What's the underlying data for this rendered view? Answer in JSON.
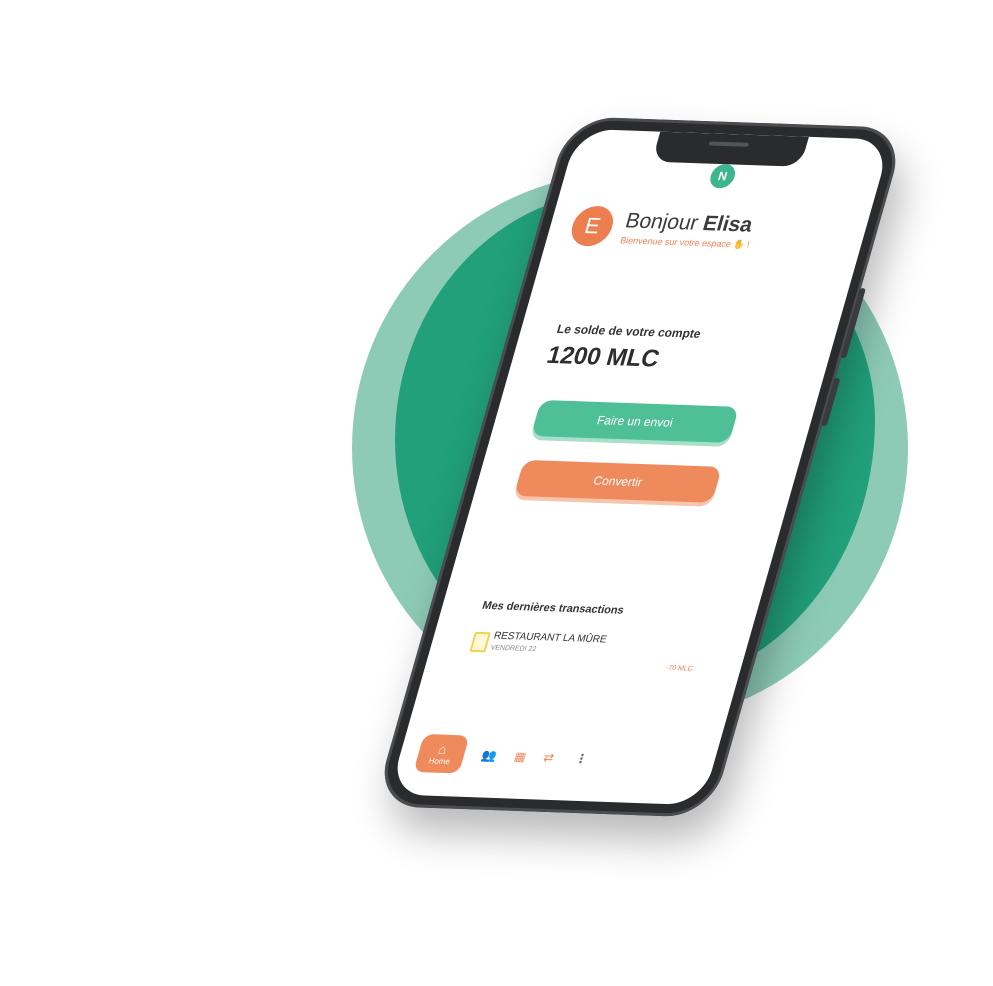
{
  "brand": {
    "badge": "N",
    "primary_color": "#21a07a",
    "accent_color": "#ec7e4f"
  },
  "user": {
    "avatar_initial": "E",
    "greeting": "Bonjour",
    "name": "Elisa",
    "welcome": "Bienvenue sur votre espace"
  },
  "balance": {
    "label": "Le solde de votre compte",
    "value": "1200 MLC"
  },
  "actions": {
    "send_label": "Faire un envoi",
    "convert_label": "Convertir"
  },
  "transactions": {
    "title": "Mes dernières transactions",
    "items": [
      {
        "icon": "receipt-icon",
        "name": "RESTAURANT LA MÛRE",
        "date": "VENDREDI 22",
        "amount": "-70 MLC"
      }
    ]
  },
  "nav": {
    "home_label": "Home",
    "items": [
      {
        "icon": "home-icon"
      },
      {
        "icon": "users-icon"
      },
      {
        "icon": "store-icon"
      },
      {
        "icon": "transfer-icon"
      },
      {
        "icon": "more-icon"
      }
    ]
  }
}
